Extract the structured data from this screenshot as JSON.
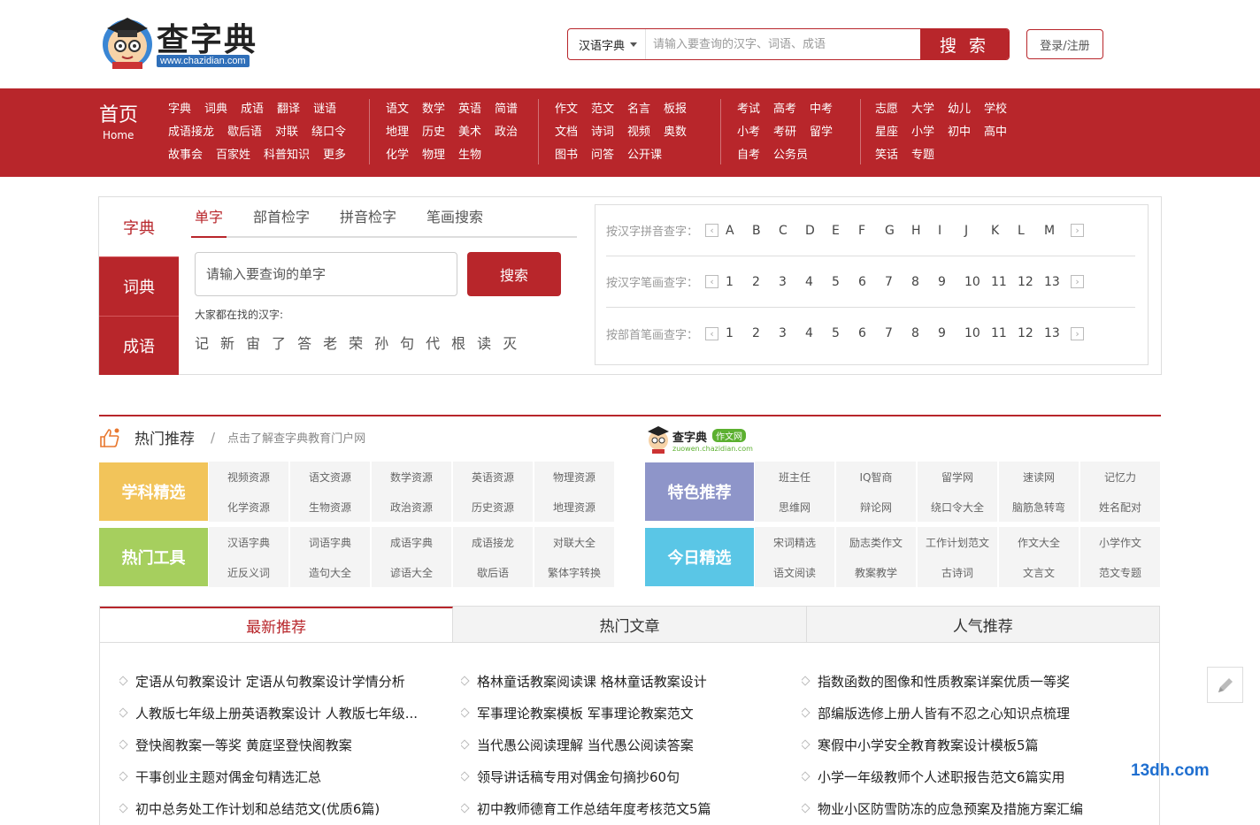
{
  "header": {
    "logo_title": "查字典",
    "logo_url": "www.chazidian.com",
    "search_select": "汉语字典",
    "search_placeholder": "请输入要查询的汉字、词语、成语",
    "search_button": "搜 索",
    "login": "登录/注册"
  },
  "nav": {
    "home_cn": "首页",
    "home_en": "Home",
    "groups": [
      [
        [
          "字典",
          "词典",
          "成语",
          "翻译",
          "谜语"
        ],
        [
          "成语接龙",
          "歇后语",
          "对联",
          "绕口令"
        ],
        [
          "故事会",
          "百家姓",
          "科普知识",
          "更多"
        ]
      ],
      [
        [
          "语文",
          "数学",
          "英语",
          "简谱"
        ],
        [
          "地理",
          "历史",
          "美术",
          "政治"
        ],
        [
          "化学",
          "物理",
          "生物"
        ]
      ],
      [
        [
          "作文",
          "范文",
          "名言",
          "板报"
        ],
        [
          "文档",
          "诗词",
          "视频",
          "奥数"
        ],
        [
          "图书",
          "问答",
          "公开课"
        ]
      ],
      [
        [
          "考试",
          "高考",
          "中考"
        ],
        [
          "小考",
          "考研",
          "留学"
        ],
        [
          "自考",
          "公务员"
        ]
      ],
      [
        [
          "志愿",
          "大学",
          "幼儿",
          "学校"
        ],
        [
          "星座",
          "小学",
          "初中",
          "高中"
        ],
        [
          "笑话",
          "专题"
        ]
      ]
    ]
  },
  "dict": {
    "side_tabs": [
      "字典",
      "词典",
      "成语"
    ],
    "sub_tabs": [
      "单字",
      "部首检字",
      "拼音检字",
      "笔画搜索"
    ],
    "input_placeholder": "请输入要查询的单字",
    "search_button": "搜索",
    "hot_label": "大家都在找的汉字:",
    "hot_chars": [
      "记",
      "新",
      "宙",
      "了",
      "答",
      "老",
      "荣",
      "孙",
      "句",
      "代",
      "根",
      "读",
      "灭"
    ],
    "lookup": [
      {
        "label": "按汉字拼音查字：",
        "items": [
          "A",
          "B",
          "C",
          "D",
          "E",
          "F",
          "G",
          "H",
          "I",
          "J",
          "K",
          "L",
          "M"
        ]
      },
      {
        "label": "按汉字笔画查字：",
        "items": [
          "1",
          "2",
          "3",
          "4",
          "5",
          "6",
          "7",
          "8",
          "9",
          "10",
          "11",
          "12",
          "13"
        ]
      },
      {
        "label": "按部首笔画查字：",
        "items": [
          "1",
          "2",
          "3",
          "4",
          "5",
          "6",
          "7",
          "8",
          "9",
          "10",
          "11",
          "12",
          "13"
        ]
      }
    ]
  },
  "hot": {
    "title": "热门推荐",
    "slash": "/",
    "subtitle": "点击了解查字典教育门户网",
    "zw_logo_text": "查字典",
    "zw_logo_badge": "作文网",
    "zw_logo_url": "zuowen.chazidian.com",
    "blocks": [
      {
        "label": "学科精选",
        "color": "#f2c45a",
        "links": [
          "视频资源",
          "语文资源",
          "数学资源",
          "英语资源",
          "物理资源",
          "化学资源",
          "生物资源",
          "政治资源",
          "历史资源",
          "地理资源"
        ]
      },
      {
        "label": "特色推荐",
        "color": "#8e95c9",
        "links": [
          "班主任",
          "IQ智商",
          "留学网",
          "速读网",
          "记忆力",
          "思维网",
          "辩论网",
          "绕口令大全",
          "脑筋急转弯",
          "姓名配对"
        ]
      },
      {
        "label": "热门工具",
        "color": "#a6cf5e",
        "links": [
          "汉语字典",
          "词语字典",
          "成语字典",
          "成语接龙",
          "对联大全",
          "近反义词",
          "造句大全",
          "谚语大全",
          "歇后语",
          "繁体字转换"
        ]
      },
      {
        "label": "今日精选",
        "color": "#5ac6e6",
        "links": [
          "宋词精选",
          "励志类作文",
          "工作计划范文",
          "作文大全",
          "小学作文",
          "语文阅读",
          "教案教学",
          "古诗词",
          "文言文",
          "范文专题"
        ]
      }
    ]
  },
  "news": {
    "tabs": [
      "最新推荐",
      "热门文章",
      "人气推荐"
    ],
    "cols": [
      [
        "定语从句教案设计 定语从句教案设计学情分析",
        "人教版七年级上册英语教案设计 人教版七年级...",
        "登快阁教案一等奖 黄庭坚登快阁教案",
        "干事创业主题对偶金句精选汇总",
        "初中总务处工作计划和总结范文(优质6篇)"
      ],
      [
        "格林童话教案阅读课 格林童话教案设计",
        "军事理论教案模板 军事理论教案范文",
        "当代愚公阅读理解 当代愚公阅读答案",
        "领导讲话稿专用对偶金句摘抄60句",
        "初中教师德育工作总结年度考核范文5篇"
      ],
      [
        "指数函数的图像和性质教案详案优质一等奖",
        "部编版选修上册人皆有不忍之心知识点梳理",
        "寒假中小学安全教育教案设计模板5篇",
        "小学一年级教师个人述职报告范文6篇实用",
        "物业小区防雪防冻的应急预案及措施方案汇编"
      ]
    ]
  },
  "watermark": "13dh.com"
}
